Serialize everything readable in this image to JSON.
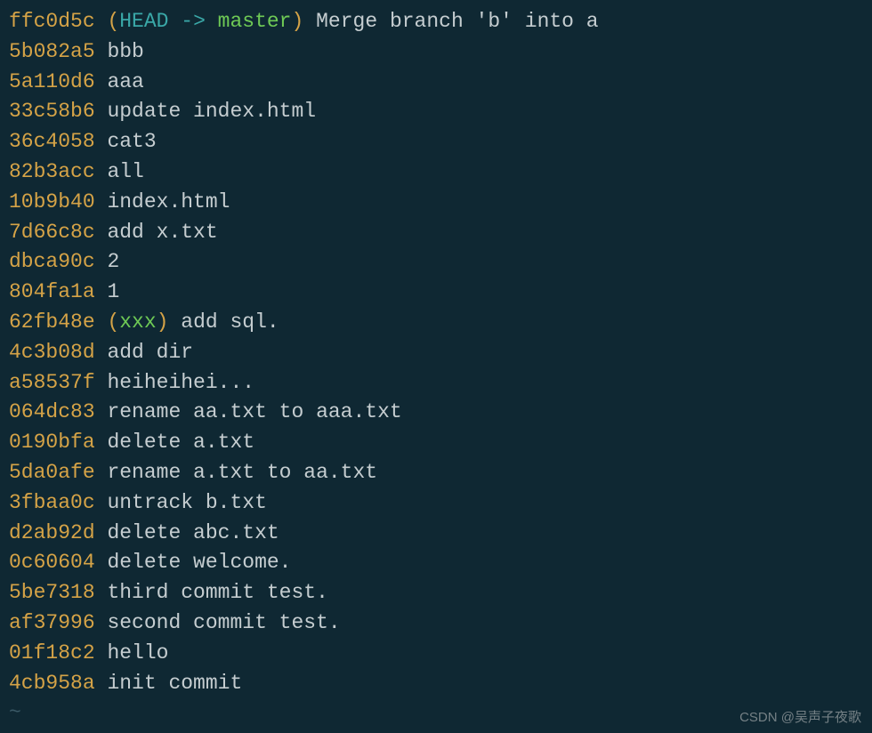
{
  "commits": [
    {
      "hash": "ffc0d5c",
      "ref_head": "HEAD -> ",
      "ref_branch": "master",
      "msg": "Merge branch 'b' into a"
    },
    {
      "hash": "5b082a5",
      "msg": "bbb"
    },
    {
      "hash": "5a110d6",
      "msg": "aaa"
    },
    {
      "hash": "33c58b6",
      "msg": "update index.html"
    },
    {
      "hash": "36c4058",
      "msg": "cat3"
    },
    {
      "hash": "82b3acc",
      "msg": "all"
    },
    {
      "hash": "10b9b40",
      "msg": "index.html"
    },
    {
      "hash": "7d66c8c",
      "msg": "add x.txt"
    },
    {
      "hash": "dbca90c",
      "msg": "2"
    },
    {
      "hash": "804fa1a",
      "msg": "1"
    },
    {
      "hash": "62fb48e",
      "ref_branch": "xxx",
      "msg": "add sql."
    },
    {
      "hash": "4c3b08d",
      "msg": "add dir"
    },
    {
      "hash": "a58537f",
      "msg": "heiheihei..."
    },
    {
      "hash": "064dc83",
      "msg": "rename aa.txt to aaa.txt"
    },
    {
      "hash": "0190bfa",
      "msg": "delete a.txt"
    },
    {
      "hash": "5da0afe",
      "msg": "rename a.txt to aa.txt"
    },
    {
      "hash": "3fbaa0c",
      "msg": "untrack b.txt"
    },
    {
      "hash": "d2ab92d",
      "msg": "delete abc.txt"
    },
    {
      "hash": "0c60604",
      "msg": "delete welcome."
    },
    {
      "hash": "5be7318",
      "msg": "third commit test."
    },
    {
      "hash": "af37996",
      "msg": "second commit test."
    },
    {
      "hash": "01f18c2",
      "msg": "hello"
    },
    {
      "hash": "4cb958a",
      "msg": "init commit"
    }
  ],
  "tilde": "~",
  "watermark": "CSDN @吴声子夜歌",
  "paren_open": "(",
  "paren_close": ")"
}
